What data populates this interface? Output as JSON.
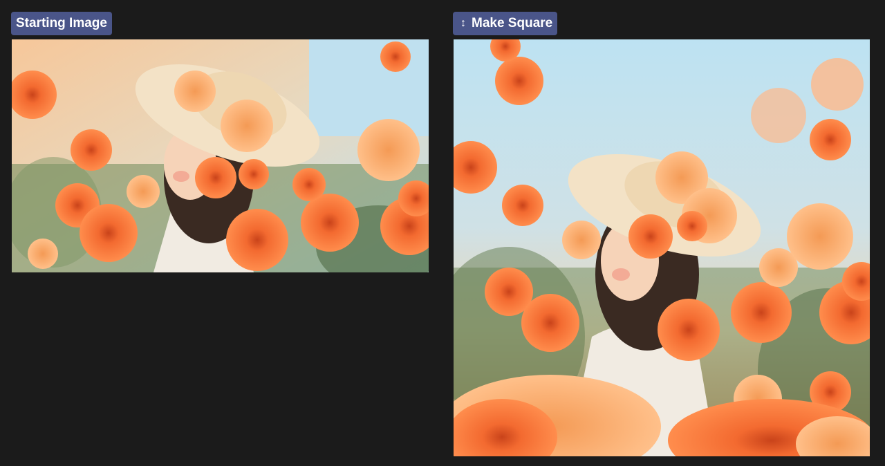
{
  "starting": {
    "label": "Starting Image",
    "image": {
      "icon": "poppy-field-girl-image",
      "alt": "Girl in sun hat among orange poppies"
    }
  },
  "make_square": {
    "label": "Make Square",
    "icon": "vertical-resize-icon",
    "glyph": "↕",
    "image": {
      "icon": "poppy-field-girl-square-image",
      "alt": "Square version: girl in sun hat among orange poppies"
    }
  },
  "colors": {
    "background": "#1b1b1b",
    "badge": "#4a5589",
    "poppy": "#f3622a",
    "sky": "#bcdff0",
    "hat": "#f3e2c6"
  }
}
